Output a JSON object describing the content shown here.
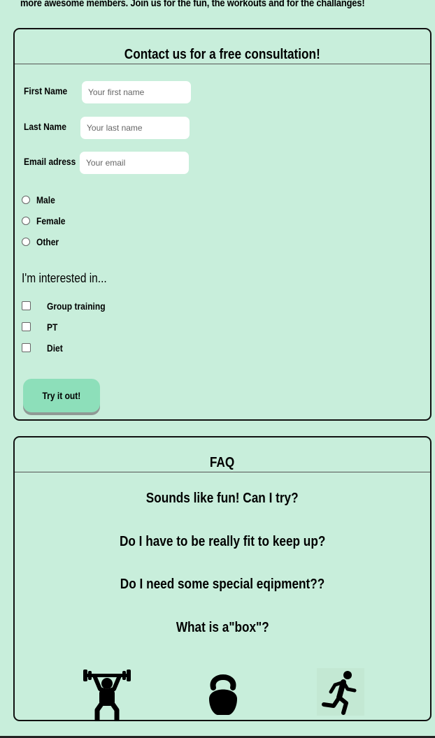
{
  "intro": {
    "text": "more awesome members. Join us for the fun, the workouts and for the challanges!"
  },
  "contact": {
    "title": "Contact us for a free consultation!",
    "fields": [
      {
        "label": "First Name",
        "placeholder": "Your first name"
      },
      {
        "label": "Last Name",
        "placeholder": "Your last name"
      },
      {
        "label": "Email adress",
        "placeholder": "Your email"
      }
    ],
    "gender_options": [
      "Male",
      "Female",
      "Other"
    ],
    "interest_title": "I'm interested in...",
    "interests": [
      "Group training",
      "PT",
      "Diet"
    ],
    "submit_label": "Try it out!"
  },
  "faq": {
    "title": "FAQ",
    "questions": [
      "Sounds like fun! Can I try?",
      "Do I have to be really fit to keep up?",
      "Do I need some special eqipment??",
      "What is a\"box\"?"
    ],
    "icons": [
      "weightlifter-icon",
      "kettlebell-icon",
      "runner-icon"
    ]
  },
  "colors": {
    "background": "#c8eedb",
    "button": "#8ddfba",
    "border": "#111111"
  }
}
